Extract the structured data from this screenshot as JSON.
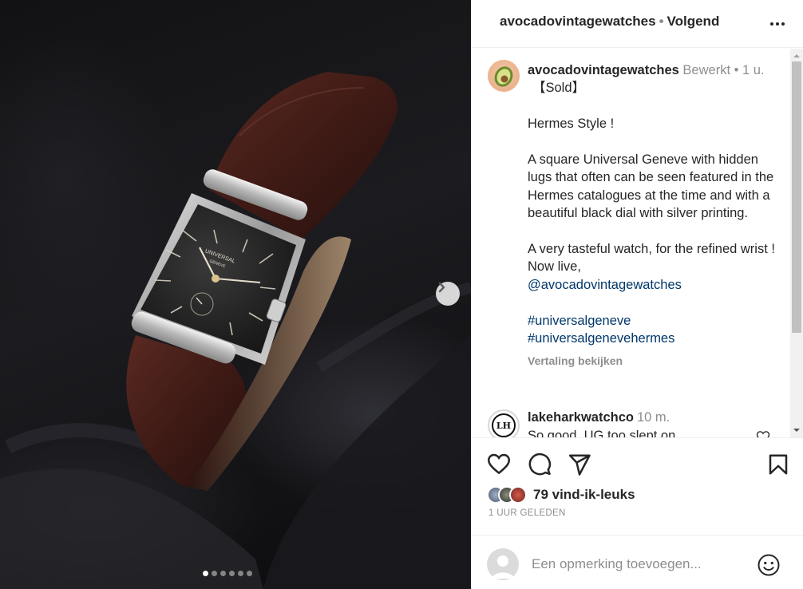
{
  "header": {
    "username": "avocadovintagewatches",
    "separator": "•",
    "follow_status": "Volgend",
    "more_icon": "more-horizontal-icon"
  },
  "caption": {
    "username": "avocadovintagewatches",
    "edited": "Bewerkt",
    "meta_sep": "•",
    "time": "1 u.",
    "line_sold": "【Sold】",
    "line_style": "Hermes Style !",
    "paragraph1": "A square Universal Geneve with hidden lugs that often can be seen featured in the Hermes catalogues at the time and with a beautiful black dial with silver printing.",
    "paragraph2": "A very tasteful watch, for the refined wrist ! Now live,",
    "mention": "@avocadovintagewatches",
    "hashtag1": "#universalgeneve",
    "hashtag2": "#universalgenevehermes",
    "translate_label": "Vertaling bekijken"
  },
  "comment": {
    "username": "lakeharkwatchco",
    "time": "10 m.",
    "text": "So good, UG too slept on"
  },
  "actions": {
    "like_icon": "heart-icon",
    "comment_icon": "comment-icon",
    "share_icon": "paper-plane-icon",
    "save_icon": "bookmark-icon",
    "likes_label": "79 vind-ik-leuks",
    "time_ago": "1 UUR GELEDEN"
  },
  "add_comment": {
    "placeholder": "Een opmerking toevoegen...",
    "emoji_icon": "smiley-icon"
  },
  "media": {
    "dial_brand": "UNIVERSAL",
    "dial_sub": "GENEVE",
    "carousel_count": 6,
    "carousel_active": 0
  },
  "colors": {
    "link": "#00376b",
    "muted": "#8e8e8e",
    "text": "#262626"
  }
}
